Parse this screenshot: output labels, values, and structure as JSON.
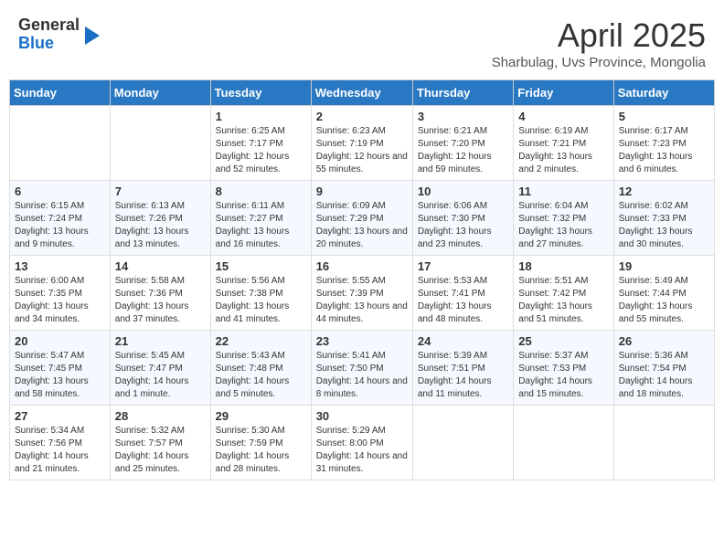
{
  "header": {
    "logo_general": "General",
    "logo_blue": "Blue",
    "month_title": "April 2025",
    "location": "Sharbulag, Uvs Province, Mongolia"
  },
  "days_of_week": [
    "Sunday",
    "Monday",
    "Tuesday",
    "Wednesday",
    "Thursday",
    "Friday",
    "Saturday"
  ],
  "weeks": [
    [
      {
        "day": "",
        "info": ""
      },
      {
        "day": "",
        "info": ""
      },
      {
        "day": "1",
        "info": "Sunrise: 6:25 AM\nSunset: 7:17 PM\nDaylight: 12 hours and 52 minutes."
      },
      {
        "day": "2",
        "info": "Sunrise: 6:23 AM\nSunset: 7:19 PM\nDaylight: 12 hours and 55 minutes."
      },
      {
        "day": "3",
        "info": "Sunrise: 6:21 AM\nSunset: 7:20 PM\nDaylight: 12 hours and 59 minutes."
      },
      {
        "day": "4",
        "info": "Sunrise: 6:19 AM\nSunset: 7:21 PM\nDaylight: 13 hours and 2 minutes."
      },
      {
        "day": "5",
        "info": "Sunrise: 6:17 AM\nSunset: 7:23 PM\nDaylight: 13 hours and 6 minutes."
      }
    ],
    [
      {
        "day": "6",
        "info": "Sunrise: 6:15 AM\nSunset: 7:24 PM\nDaylight: 13 hours and 9 minutes."
      },
      {
        "day": "7",
        "info": "Sunrise: 6:13 AM\nSunset: 7:26 PM\nDaylight: 13 hours and 13 minutes."
      },
      {
        "day": "8",
        "info": "Sunrise: 6:11 AM\nSunset: 7:27 PM\nDaylight: 13 hours and 16 minutes."
      },
      {
        "day": "9",
        "info": "Sunrise: 6:09 AM\nSunset: 7:29 PM\nDaylight: 13 hours and 20 minutes."
      },
      {
        "day": "10",
        "info": "Sunrise: 6:06 AM\nSunset: 7:30 PM\nDaylight: 13 hours and 23 minutes."
      },
      {
        "day": "11",
        "info": "Sunrise: 6:04 AM\nSunset: 7:32 PM\nDaylight: 13 hours and 27 minutes."
      },
      {
        "day": "12",
        "info": "Sunrise: 6:02 AM\nSunset: 7:33 PM\nDaylight: 13 hours and 30 minutes."
      }
    ],
    [
      {
        "day": "13",
        "info": "Sunrise: 6:00 AM\nSunset: 7:35 PM\nDaylight: 13 hours and 34 minutes."
      },
      {
        "day": "14",
        "info": "Sunrise: 5:58 AM\nSunset: 7:36 PM\nDaylight: 13 hours and 37 minutes."
      },
      {
        "day": "15",
        "info": "Sunrise: 5:56 AM\nSunset: 7:38 PM\nDaylight: 13 hours and 41 minutes."
      },
      {
        "day": "16",
        "info": "Sunrise: 5:55 AM\nSunset: 7:39 PM\nDaylight: 13 hours and 44 minutes."
      },
      {
        "day": "17",
        "info": "Sunrise: 5:53 AM\nSunset: 7:41 PM\nDaylight: 13 hours and 48 minutes."
      },
      {
        "day": "18",
        "info": "Sunrise: 5:51 AM\nSunset: 7:42 PM\nDaylight: 13 hours and 51 minutes."
      },
      {
        "day": "19",
        "info": "Sunrise: 5:49 AM\nSunset: 7:44 PM\nDaylight: 13 hours and 55 minutes."
      }
    ],
    [
      {
        "day": "20",
        "info": "Sunrise: 5:47 AM\nSunset: 7:45 PM\nDaylight: 13 hours and 58 minutes."
      },
      {
        "day": "21",
        "info": "Sunrise: 5:45 AM\nSunset: 7:47 PM\nDaylight: 14 hours and 1 minute."
      },
      {
        "day": "22",
        "info": "Sunrise: 5:43 AM\nSunset: 7:48 PM\nDaylight: 14 hours and 5 minutes."
      },
      {
        "day": "23",
        "info": "Sunrise: 5:41 AM\nSunset: 7:50 PM\nDaylight: 14 hours and 8 minutes."
      },
      {
        "day": "24",
        "info": "Sunrise: 5:39 AM\nSunset: 7:51 PM\nDaylight: 14 hours and 11 minutes."
      },
      {
        "day": "25",
        "info": "Sunrise: 5:37 AM\nSunset: 7:53 PM\nDaylight: 14 hours and 15 minutes."
      },
      {
        "day": "26",
        "info": "Sunrise: 5:36 AM\nSunset: 7:54 PM\nDaylight: 14 hours and 18 minutes."
      }
    ],
    [
      {
        "day": "27",
        "info": "Sunrise: 5:34 AM\nSunset: 7:56 PM\nDaylight: 14 hours and 21 minutes."
      },
      {
        "day": "28",
        "info": "Sunrise: 5:32 AM\nSunset: 7:57 PM\nDaylight: 14 hours and 25 minutes."
      },
      {
        "day": "29",
        "info": "Sunrise: 5:30 AM\nSunset: 7:59 PM\nDaylight: 14 hours and 28 minutes."
      },
      {
        "day": "30",
        "info": "Sunrise: 5:29 AM\nSunset: 8:00 PM\nDaylight: 14 hours and 31 minutes."
      },
      {
        "day": "",
        "info": ""
      },
      {
        "day": "",
        "info": ""
      },
      {
        "day": "",
        "info": ""
      }
    ]
  ]
}
